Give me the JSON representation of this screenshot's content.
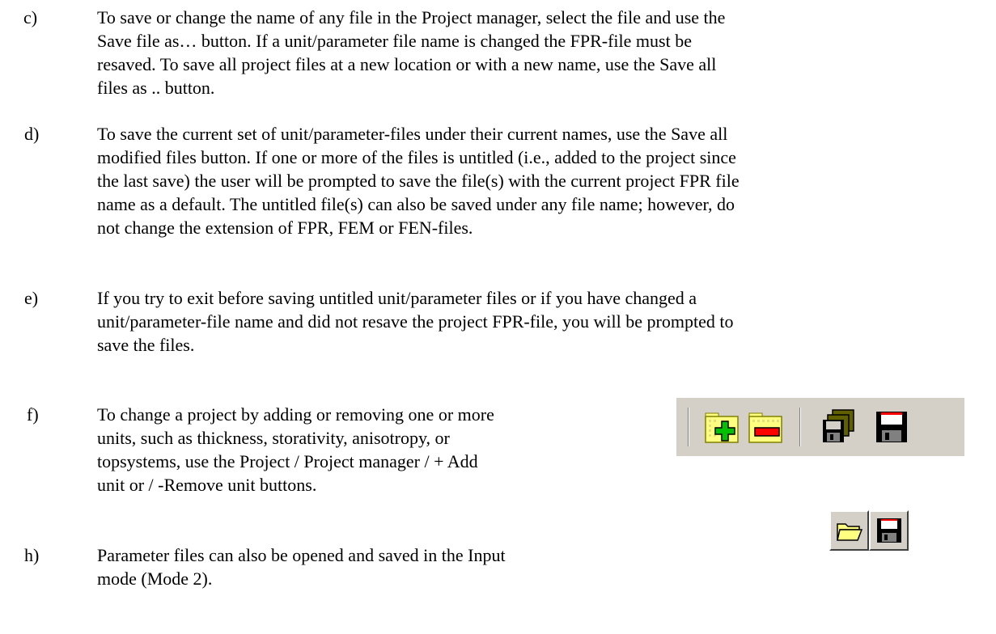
{
  "items": [
    {
      "letter": "c)",
      "lines": [
        "To save or change the name of any file in the Project manager, select the file and use the",
        "Save file as… button. If a unit/parameter file name is changed the FPR-file must be",
        "resaved. To save all project files at a new location or with a new name, use the Save all",
        "files as .. button."
      ]
    },
    {
      "letter": "d)",
      "lines": [
        "To save the current set of unit/parameter-files under their current names, use the Save all",
        "modified files button. If one or more of the files is untitled (i.e., added to the project since",
        "the last save) the user will be prompted to save the file(s) with the current project FPR file",
        "name as a default. The untitled file(s) can also be saved under any file name; however, do",
        "not change the extension of FPR, FEM or FEN-files."
      ]
    },
    {
      "letter": "e)",
      "lines": [
        "If you try to exit before saving untitled unit/parameter files or if you have changed a",
        "unit/parameter-file name and did not resave the project FPR-file, you will be prompted to",
        "save the files."
      ]
    },
    {
      "letter": "f)",
      "lines": [
        "To change a project by adding or removing one or more",
        "units, such as thickness, storativity, anisotropy, or",
        "topsystems, use the Project / Project manager / + Add",
        "unit or / -Remove unit buttons."
      ]
    },
    {
      "letter": "h)",
      "lines": [
        "Parameter files can also be opened and saved in the Input",
        "mode (Mode 2)."
      ]
    }
  ],
  "toolbar_project": {
    "icons": [
      "add-unit-icon",
      "remove-unit-icon",
      "save-all-files-icon",
      "save-file-icon"
    ]
  },
  "toolbar_input": {
    "icons": [
      "open-file-icon",
      "save-file-icon"
    ]
  },
  "colors": {
    "toolbar_bg": "#d4d0c8",
    "folder_yellow": "#ffff80",
    "plus_green": "#00c000",
    "minus_red": "#ff0000",
    "disk_dark": "#000000"
  }
}
